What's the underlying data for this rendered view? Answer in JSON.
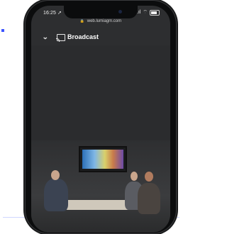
{
  "status_bar": {
    "time": "16:25",
    "location_glyph": "➚",
    "signal_glyph": ".ıl",
    "wifi_glyph": "⌔"
  },
  "browser": {
    "url": "web.lumiagm.com",
    "lock_glyph": "🔒"
  },
  "app_bar": {
    "back_glyph": "⌄",
    "title": "Broadcast"
  },
  "colors": {
    "accent": "#3d55ff",
    "screen_bg": "#2d2e30"
  },
  "icons": [
    "chevron-down-icon",
    "cast-icon",
    "lock-icon",
    "battery-icon",
    "wifi-icon",
    "signal-icon"
  ]
}
